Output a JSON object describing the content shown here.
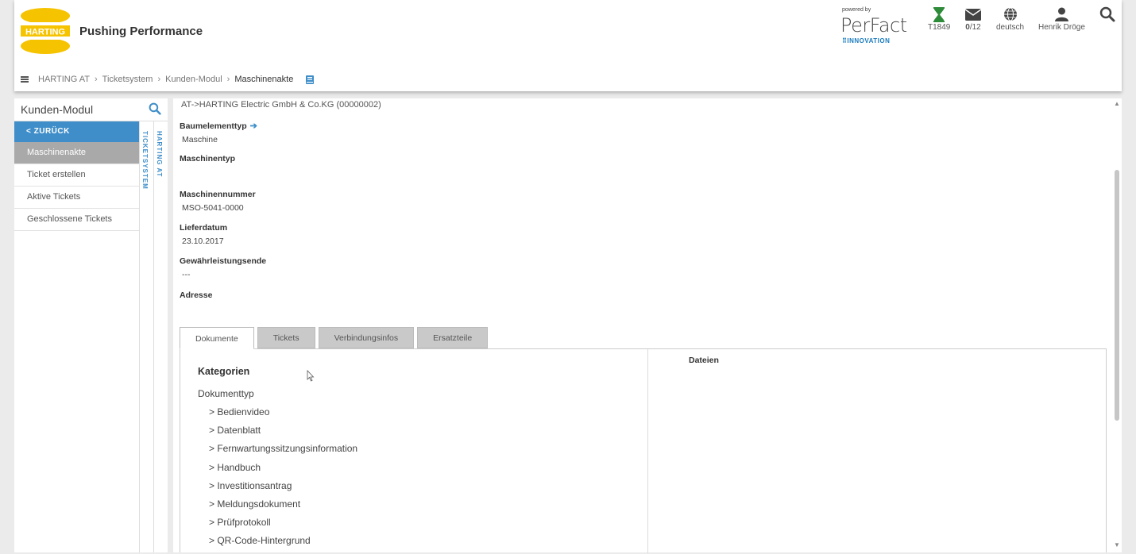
{
  "header": {
    "brand_logo_text": "HARTING",
    "brand_tagline": "Pushing Performance",
    "powered_by": "powered by",
    "perfact_name": "PerFact",
    "perfact_innovation": "INNOVATION",
    "ticket_label": "T1849",
    "messages_bold": "0",
    "messages_rest": "/12",
    "language_label": "deutsch",
    "user_label": "Henrik Dröge"
  },
  "breadcrumb": {
    "items": [
      "HARTING AT",
      "Ticketsystem",
      "Kunden-Modul"
    ],
    "current": "Maschinenakte",
    "separator": "›"
  },
  "sidebar": {
    "title": "Kunden-Modul",
    "back_label": "< ZURÜCK",
    "items": [
      {
        "label": "Maschinenakte",
        "active": true
      },
      {
        "label": "Ticket erstellen",
        "active": false
      },
      {
        "label": "Aktive Tickets",
        "active": false
      },
      {
        "label": "Geschlossene Tickets",
        "active": false
      }
    ],
    "vertical_tabs": [
      "TICKETSYSTEM",
      "HARTING AT"
    ]
  },
  "main": {
    "path": "AT->HARTING Electric GmbH & Co.KG (00000002)",
    "fields": [
      {
        "label": "Baumelementtyp",
        "value": "Maschine"
      },
      {
        "label": "Maschinentyp",
        "value": ""
      },
      {
        "label": "Maschinennummer",
        "value": "MSO-5041-0000"
      },
      {
        "label": "Lieferdatum",
        "value": "23.10.2017"
      },
      {
        "label": "Gewährleistungsende",
        "value": "---"
      },
      {
        "label": "Adresse",
        "value": ""
      }
    ],
    "tabs": [
      "Dokumente",
      "Tickets",
      "Verbindungsinfos",
      "Ersatzteile"
    ],
    "active_tab": "Dokumente",
    "categories_title": "Kategorien",
    "category_group": "Dokumenttyp",
    "category_items": [
      "> Bedienvideo",
      "> Datenblatt",
      "> Fernwartungssitzungsinformation",
      "> Handbuch",
      "> Investitionsantrag",
      "> Meldungsdokument",
      "> Prüfprotokoll",
      "> QR-Code-Hintergrund"
    ],
    "files_title": "Dateien"
  },
  "colors": {
    "accent": "#3f8ec9",
    "harting_yellow": "#f6c300",
    "ticket_green": "#2e8b3a",
    "active_menu": "#a9a9a9"
  }
}
